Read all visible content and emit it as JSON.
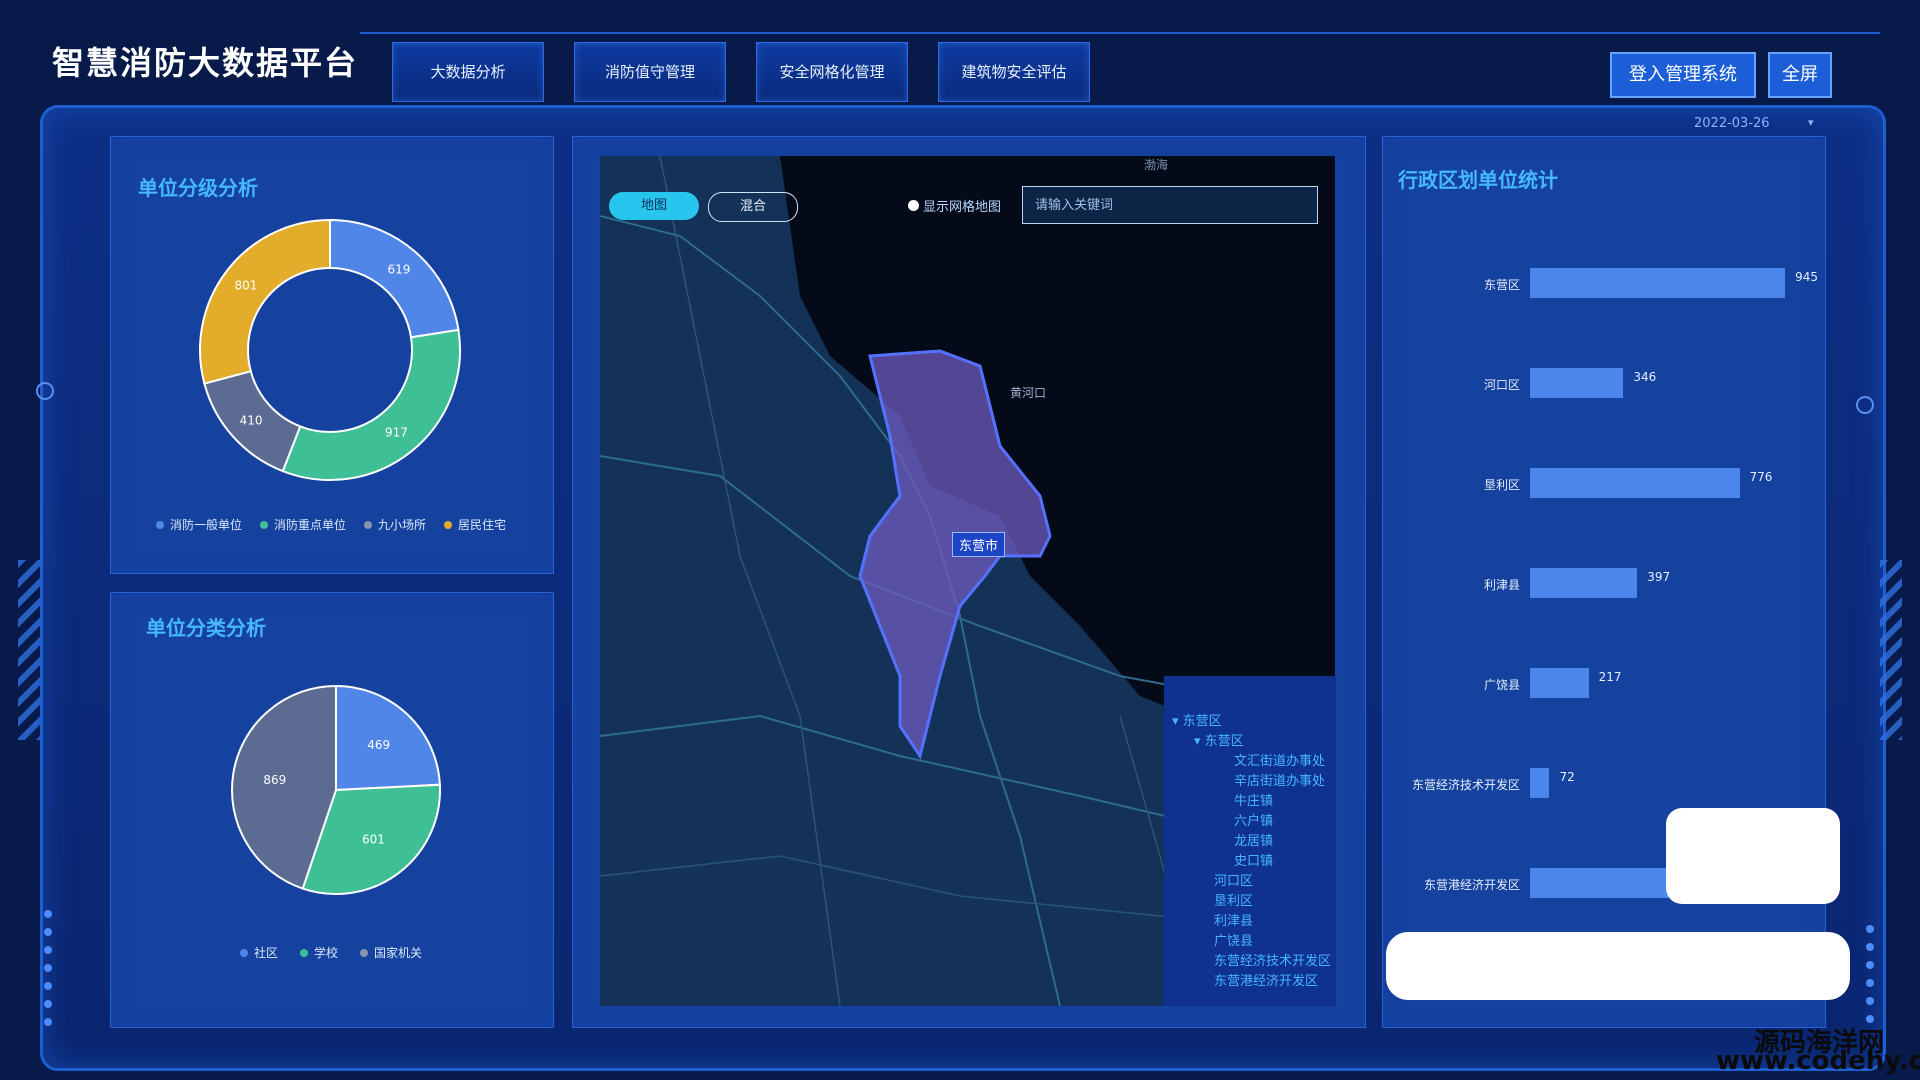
{
  "header": {
    "title": "智慧消防大数据平台",
    "nav_tabs": [
      "大数据分析",
      "消防值守管理",
      "安全网格化管理",
      "建筑物安全评估"
    ],
    "admin_button": "登入管理系统",
    "fullscreen_button": "全屏",
    "date": "2022-03-26"
  },
  "unit_level": {
    "title": "单位分级分析",
    "slices": [
      {
        "name": "消防一般单位",
        "value": 619,
        "color": "#4f86e8"
      },
      {
        "name": "消防重点单位",
        "value": 917,
        "color": "#3fbf95"
      },
      {
        "name": "九小场所",
        "value": 410,
        "color": "#5b6b92"
      },
      {
        "name": "居民住宅",
        "value": 801,
        "color": "#e3ad2b"
      }
    ]
  },
  "unit_category": {
    "title": "单位分类分析",
    "slices": [
      {
        "name": "社区",
        "value": 469,
        "color": "#4f86e8"
      },
      {
        "name": "学校",
        "value": 601,
        "color": "#3fbf95"
      },
      {
        "name": "国家机关",
        "value": 869,
        "color": "#5b6b92"
      }
    ]
  },
  "map": {
    "mode_map": "地图",
    "mode_mixed": "混合",
    "grid_toggle": "显示网格地图",
    "search_placeholder": "请输入关键词",
    "city_label": "东营市",
    "sea_label": "渤海",
    "river_label": "黄河口",
    "tree": {
      "root": "东营区",
      "child": "东营区",
      "towns": [
        "文汇街道办事处",
        "辛店街道办事处",
        "牛庄镇",
        "六户镇",
        "龙居镇",
        "史口镇"
      ],
      "others": [
        "河口区",
        "垦利区",
        "利津县",
        "广饶县",
        "东营经济技术开发区",
        "东营港经济开发区"
      ]
    }
  },
  "district_stats": {
    "title": "行政区划单位统计",
    "chart_data": {
      "type": "bar",
      "orientation": "horizontal",
      "categories": [
        "东营区",
        "河口区",
        "垦利区",
        "利津县",
        "广饶县",
        "东营经济技术开发区",
        "东营港经济开发区"
      ],
      "values": [
        945,
        346,
        776,
        397,
        217,
        72,
        null
      ],
      "xlim": [
        0,
        1000
      ]
    }
  },
  "watermark": {
    "line1": "源码海洋网",
    "line2": "www.codehy.com"
  }
}
